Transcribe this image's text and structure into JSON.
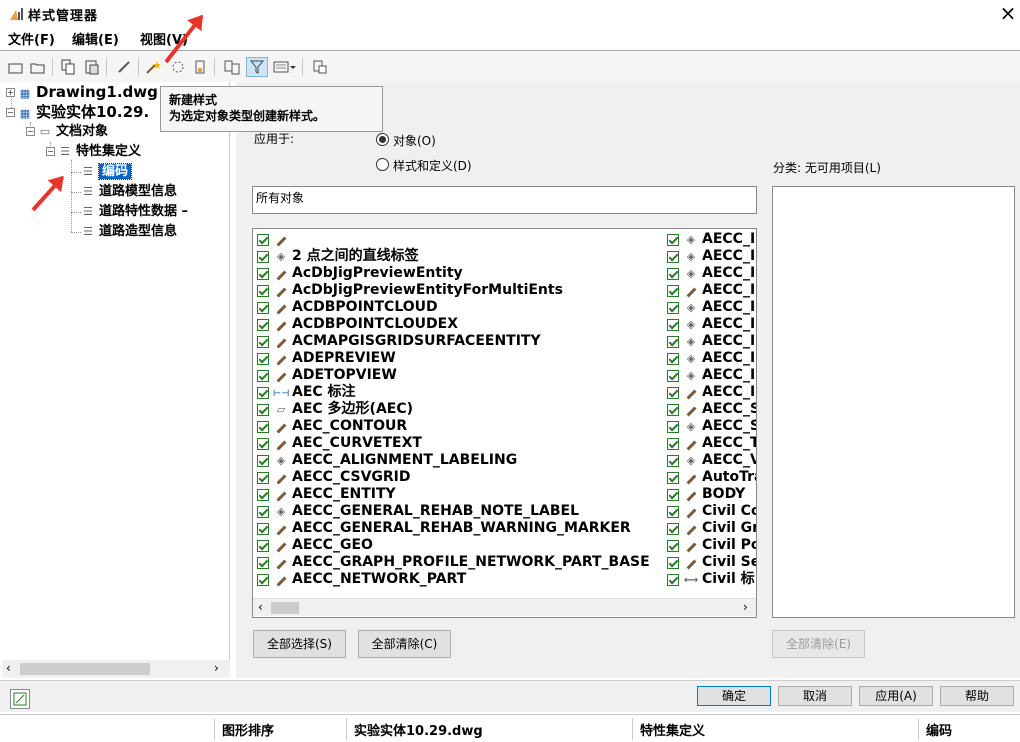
{
  "app": {
    "title": "样式管理器",
    "close_glyph": "×"
  },
  "menu": [
    {
      "label": "文件(F)"
    },
    {
      "label": "编辑(E)"
    },
    {
      "label": "视图(V)"
    }
  ],
  "toolbar": {
    "buttons": [
      "new-icon",
      "open-icon",
      "copy-icon",
      "paste-icon",
      "edit-style-icon",
      "new-style-icon",
      "purge-icon",
      "set-from-icon",
      "compare-icon",
      "filter-icon",
      "view-toggle-icon",
      "properties-icon"
    ]
  },
  "tooltip": {
    "title": "新建样式",
    "description": "为选定对象类型创建新样式。"
  },
  "tree": {
    "drawing1": "Drawing1.dwg",
    "drawing2": "实验实体10.29.",
    "doc_objects": "文档对象",
    "pset_defs": "特性集定义",
    "items": [
      "编码",
      "道路模型信息",
      "道路特性数据 –",
      "道路造型信息"
    ]
  },
  "right": {
    "applies_to_label": "应用于:",
    "radio_objects": "对象(O)",
    "radio_styles": "样式和定义(D)",
    "filter_value": "所有对象",
    "unavailable_label": "分类: 无可用项目(L)",
    "col1": [
      {
        "icon": "brush",
        "text": ""
      },
      {
        "icon": "tag",
        "text": "2 点之间的直线标签"
      },
      {
        "icon": "brush",
        "text": "AcDbJigPreviewEntity"
      },
      {
        "icon": "brush",
        "text": "AcDbJigPreviewEntityForMultiEnts"
      },
      {
        "icon": "brush",
        "text": "ACDBPOINTCLOUD"
      },
      {
        "icon": "brush",
        "text": "ACDBPOINTCLOUDEX"
      },
      {
        "icon": "brush",
        "text": "ACMAPGISGRIDSURFACEENTITY"
      },
      {
        "icon": "brush",
        "text": "ADEPREVIEW"
      },
      {
        "icon": "brush",
        "text": "ADETOPVIEW"
      },
      {
        "icon": "dim",
        "text": "AEC 标注"
      },
      {
        "icon": "poly",
        "text": "AEC 多边形(AEC)"
      },
      {
        "icon": "brush",
        "text": "AEC_CONTOUR"
      },
      {
        "icon": "brush",
        "text": "AEC_CURVETEXT"
      },
      {
        "icon": "tag",
        "text": "AECC_ALIGNMENT_LABELING"
      },
      {
        "icon": "brush",
        "text": "AECC_CSVGRID"
      },
      {
        "icon": "brush",
        "text": "AECC_ENTITY"
      },
      {
        "icon": "tag",
        "text": "AECC_GENERAL_REHAB_NOTE_LABEL"
      },
      {
        "icon": "brush",
        "text": "AECC_GENERAL_REHAB_WARNING_MARKER"
      },
      {
        "icon": "brush",
        "text": "AECC_GEO"
      },
      {
        "icon": "brush",
        "text": "AECC_GRAPH_PROFILE_NETWORK_PART_BASE"
      },
      {
        "icon": "brush",
        "text": "AECC_NETWORK_PART"
      }
    ],
    "col2": [
      {
        "icon": "tag",
        "text": "AECC_I"
      },
      {
        "icon": "tag",
        "text": "AECC_I"
      },
      {
        "icon": "tag",
        "text": "AECC_I"
      },
      {
        "icon": "brush",
        "text": "AECC_I"
      },
      {
        "icon": "tag",
        "text": "AECC_I"
      },
      {
        "icon": "tag",
        "text": "AECC_I"
      },
      {
        "icon": "tag",
        "text": "AECC_I"
      },
      {
        "icon": "tag",
        "text": "AECC_I"
      },
      {
        "icon": "tag",
        "text": "AECC_I"
      },
      {
        "icon": "brush",
        "text": "AECC_I"
      },
      {
        "icon": "brush",
        "text": "AECC_S"
      },
      {
        "icon": "tag",
        "text": "AECC_S"
      },
      {
        "icon": "brush",
        "text": "AECC_T"
      },
      {
        "icon": "tag",
        "text": "AECC_V"
      },
      {
        "icon": "brush",
        "text": "AutoTra"
      },
      {
        "icon": "brush",
        "text": "BODY"
      },
      {
        "icon": "brush",
        "text": "Civil Co"
      },
      {
        "icon": "brush",
        "text": "Civil Gr"
      },
      {
        "icon": "brush",
        "text": "Civil Po"
      },
      {
        "icon": "brush",
        "text": "Civil Se"
      },
      {
        "icon": "line",
        "text": "Civil 标"
      }
    ],
    "select_all": "全部选择(S)",
    "clear_all": "全部清除(C)",
    "clear_all_disabled": "全部清除(E)"
  },
  "dialog_buttons": {
    "ok": "确定",
    "cancel": "取消",
    "apply": "应用(A)",
    "help": "帮助"
  },
  "status": {
    "sort": "图形排序",
    "drawing": "实验实体10.29.dwg",
    "pset": "特性集定义",
    "current": "编码"
  }
}
